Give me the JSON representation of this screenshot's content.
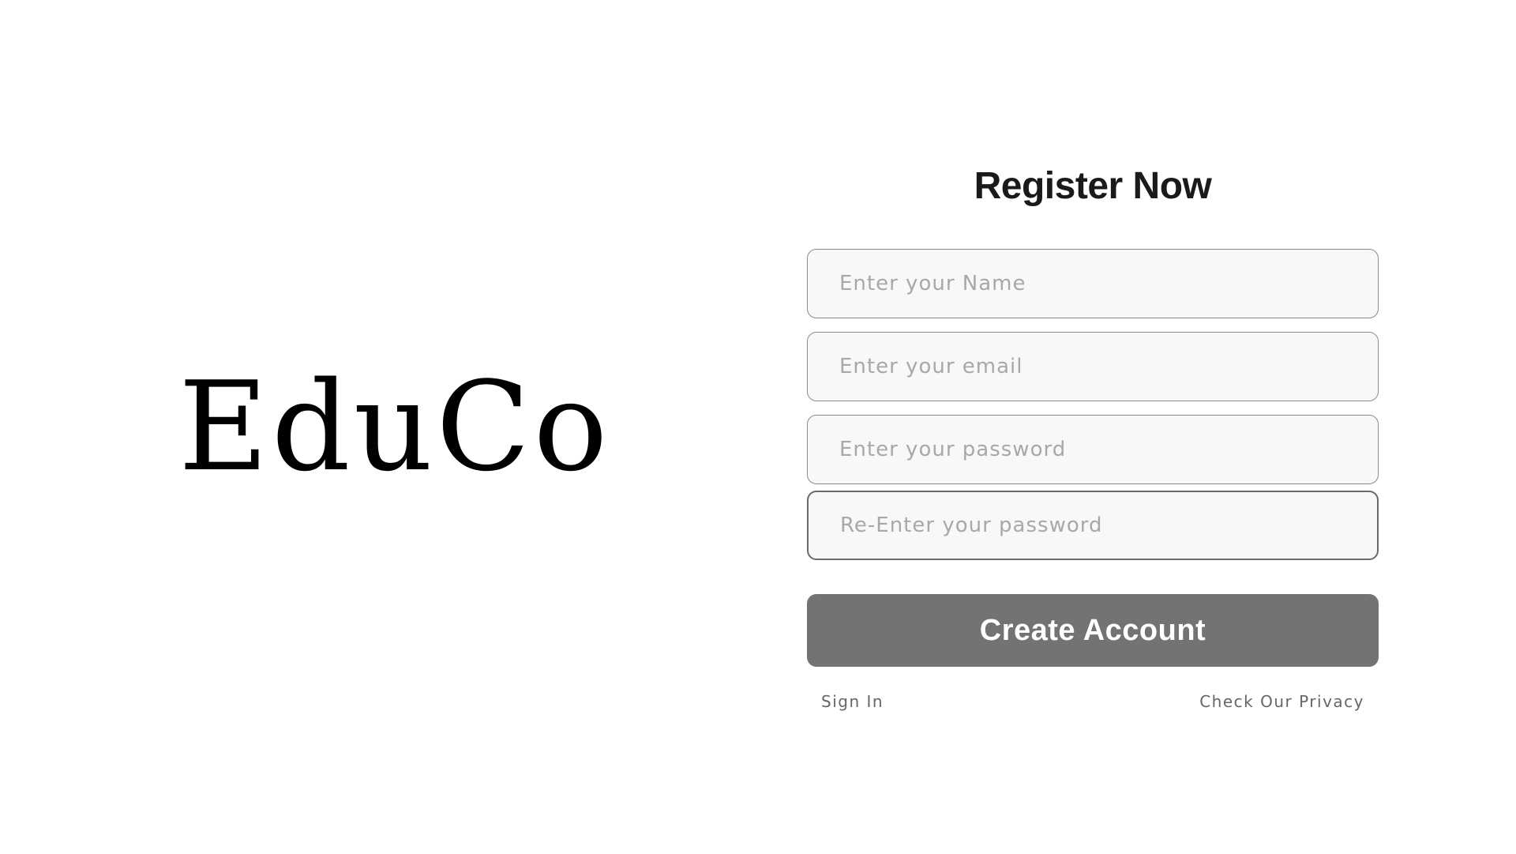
{
  "brand": {
    "logo_text": "EduCo"
  },
  "register": {
    "title": "Register Now",
    "fields": [
      {
        "placeholder": "Enter your Name",
        "value": ""
      },
      {
        "placeholder": "Enter your email",
        "value": ""
      },
      {
        "placeholder": "Enter your password",
        "value": ""
      },
      {
        "placeholder": "Re-Enter your password",
        "value": ""
      }
    ],
    "submit_label": "Create Account",
    "sign_in_label": "Sign In",
    "privacy_label": "Check Our Privacy"
  },
  "colors": {
    "background": "#ffffff",
    "button": "#737373",
    "input_background": "#f7f8fa",
    "input_border": "#8a8a8a"
  }
}
